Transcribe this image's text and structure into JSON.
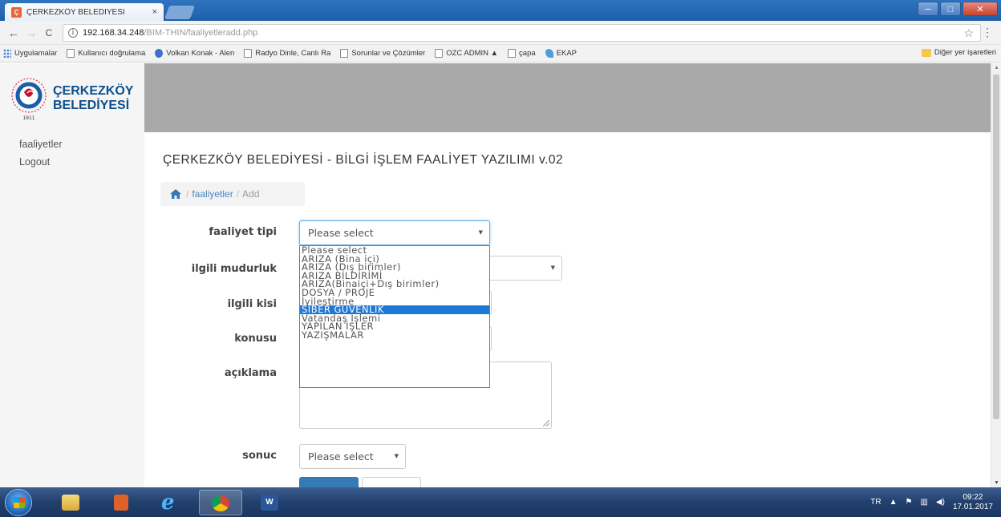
{
  "browser": {
    "tab_title": "ÇERKEZKÖY BELEDİYESİ",
    "tab_close": "×",
    "url_host": "192.168.34.248",
    "url_path": "/BIM-THIN/faaliyetleradd.php",
    "nav_back": "←",
    "nav_forward": "→",
    "nav_reload": "C",
    "star": "☆",
    "menu": "⋮",
    "bookmarks": [
      {
        "label": "Uygulamalar"
      },
      {
        "label": "Kullanıcı doğrulama"
      },
      {
        "label": "Volkan Konak - Alen"
      },
      {
        "label": "Radyo Dinle, Canlı Ra"
      },
      {
        "label": "Sorunlar ve Çözümler"
      },
      {
        "label": "OZC ADMIN ▲"
      },
      {
        "label": "çapa"
      },
      {
        "label": "EKAP"
      }
    ],
    "other_bookmarks": "Diğer yer işaretleri",
    "window_min": "─",
    "window_max": "□",
    "window_close": "✕"
  },
  "logo": {
    "line1": "ÇERKEZKÖY",
    "line2": "BELEDİYESİ",
    "year": "1911"
  },
  "sidebar": {
    "items": [
      {
        "label": "faaliyetler"
      },
      {
        "label": "Logout"
      }
    ]
  },
  "main": {
    "title": "ÇERKEZKÖY BELEDİYESİ - BİLGİ İŞLEM FAALİYET YAZILIMI v.02",
    "breadcrumb": {
      "sep": "/",
      "link": "faaliyetler",
      "current": "Add"
    }
  },
  "form": {
    "faaliyet_tipi_label": "faaliyet tipi",
    "faaliyet_tipi_value": "Please select",
    "ilgili_mudurluk_label": "ilgili mudurluk",
    "ilgili_kisi_label": "ilgili kisi",
    "konusu_label": "konusu",
    "aciklama_label": "açıklama",
    "sonuc_label": "sonuc",
    "sonuc_value": "Please select",
    "faaliyet_tipi_options": [
      "Please select",
      "ARIZA (Bina içi)",
      "ARIZA (Dış birimler)",
      "ARIZA BİLDİRİMİ",
      "ARIZA(Binaiçi+Dış birimler)",
      "DOSYA / PROJE",
      "İyileştirme",
      "SİBER GÜVENLİK",
      "Vatandaş İşlemi",
      "YAPILAN İŞLER",
      "YAZIŞMALAR"
    ],
    "faaliyet_tipi_highlighted": "SİBER GÜVENLİK"
  },
  "taskbar": {
    "lang": "TR",
    "time": "09:22",
    "date": "17.01.2017"
  }
}
